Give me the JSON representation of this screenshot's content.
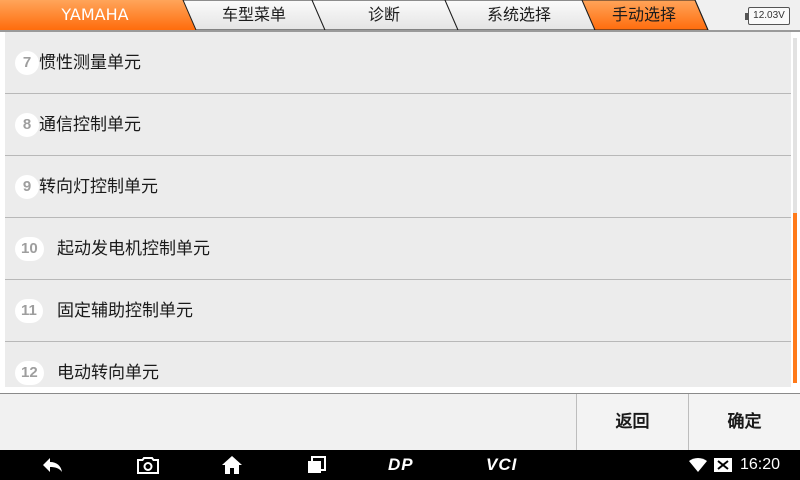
{
  "breadcrumb": {
    "items": [
      {
        "label": "YAMAHA"
      },
      {
        "label": "车型菜单"
      },
      {
        "label": "诊断"
      },
      {
        "label": "系统选择"
      },
      {
        "label": "手动选择"
      }
    ],
    "active_index": 4
  },
  "battery": {
    "voltage": "12.03V"
  },
  "list": {
    "items": [
      {
        "num": "7",
        "label": "惯性测量单元"
      },
      {
        "num": "8",
        "label": "通信控制单元"
      },
      {
        "num": "9",
        "label": "转向灯控制单元"
      },
      {
        "num": "10",
        "label": "起动发电机控制单元"
      },
      {
        "num": "11",
        "label": "固定辅助控制单元"
      },
      {
        "num": "12",
        "label": "电动转向单元"
      }
    ]
  },
  "actions": {
    "back_label": "返回",
    "ok_label": "确定"
  },
  "navbar": {
    "icons": [
      "back-icon",
      "camera-icon",
      "home-icon",
      "recent-apps-icon"
    ],
    "dp_text": "DP",
    "vci_text": "VCI",
    "wifi_icon": "wifi-icon",
    "signal_icon": "no-sim-icon",
    "time": "16:20"
  },
  "colors": {
    "accent": "#ff7a1a",
    "crumb_inactive": "#f3f3f3",
    "list_bg": "#ececec",
    "nav_bg": "#000000"
  }
}
